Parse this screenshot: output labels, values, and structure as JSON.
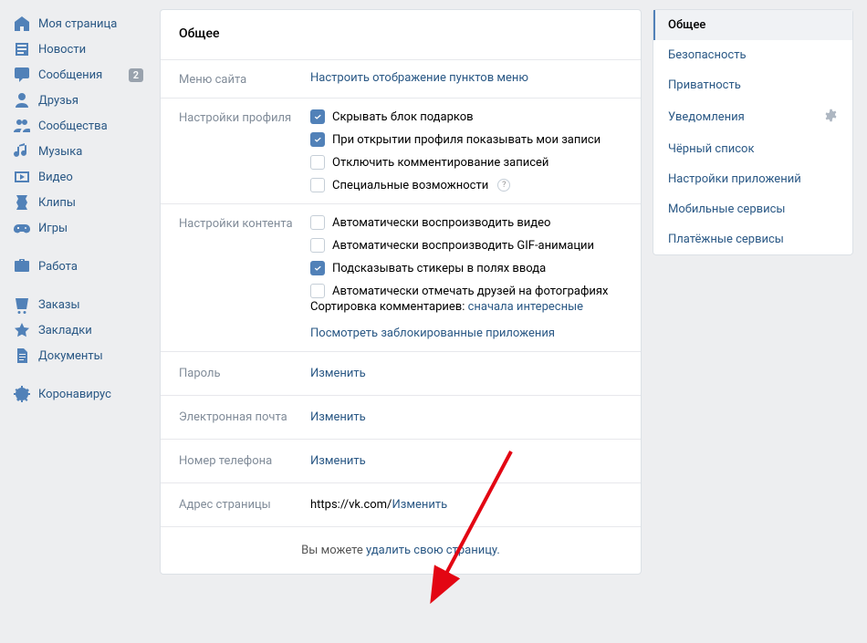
{
  "leftnav": {
    "items": [
      {
        "label": "Моя страница",
        "icon": "home"
      },
      {
        "label": "Новости",
        "icon": "news"
      },
      {
        "label": "Сообщения",
        "icon": "messages",
        "badge": "2"
      },
      {
        "label": "Друзья",
        "icon": "friends"
      },
      {
        "label": "Сообщества",
        "icon": "groups"
      },
      {
        "label": "Музыка",
        "icon": "music"
      },
      {
        "label": "Видео",
        "icon": "video"
      },
      {
        "label": "Клипы",
        "icon": "clips"
      },
      {
        "label": "Игры",
        "icon": "games"
      }
    ],
    "group2": [
      {
        "label": "Работа",
        "icon": "work"
      }
    ],
    "group3": [
      {
        "label": "Заказы",
        "icon": "orders"
      },
      {
        "label": "Закладки",
        "icon": "bookmarks"
      },
      {
        "label": "Документы",
        "icon": "documents"
      }
    ],
    "group4": [
      {
        "label": "Коронавирус",
        "icon": "covid"
      }
    ]
  },
  "main": {
    "title": "Общее",
    "menu_label": "Меню сайта",
    "menu_link": "Настроить отображение пунктов меню",
    "profile_label": "Настройки профиля",
    "profile_checks": [
      {
        "label": "Скрывать блок подарков",
        "checked": true
      },
      {
        "label": "При открытии профиля показывать мои записи",
        "checked": true
      },
      {
        "label": "Отключить комментирование записей",
        "checked": false
      },
      {
        "label": "Специальные возможности",
        "checked": false,
        "help": true
      }
    ],
    "content_label": "Настройки контента",
    "content_checks": [
      {
        "label": "Автоматически воспроизводить видео",
        "checked": false
      },
      {
        "label": "Автоматически воспроизводить GIF-анимации",
        "checked": false
      },
      {
        "label": "Подсказывать стикеры в полях ввода",
        "checked": true
      },
      {
        "label": "Автоматически отмечать друзей на фотографиях",
        "checked": false
      }
    ],
    "sort_prefix": "Сортировка комментариев: ",
    "sort_link": "сначала интересные",
    "blocked_apps_link": "Посмотреть заблокированные приложения",
    "rows": [
      {
        "label": "Пароль",
        "value": "",
        "action": "Изменить"
      },
      {
        "label": "Электронная почта",
        "value": "",
        "action": "Изменить"
      },
      {
        "label": "Номер телефона",
        "value": "",
        "action": "Изменить"
      },
      {
        "label": "Адрес страницы",
        "value": "https://vk.com/",
        "action": "Изменить"
      }
    ],
    "footer_prefix": "Вы можете ",
    "footer_link": "удалить свою страницу."
  },
  "right": {
    "items": [
      {
        "label": "Общее",
        "active": true
      },
      {
        "label": "Безопасность"
      },
      {
        "label": "Приватность"
      },
      {
        "label": "Уведомления",
        "gear": true
      },
      {
        "label": "Чёрный список"
      },
      {
        "label": "Настройки приложений"
      },
      {
        "label": "Мобильные сервисы"
      },
      {
        "label": "Платёжные сервисы"
      }
    ]
  }
}
